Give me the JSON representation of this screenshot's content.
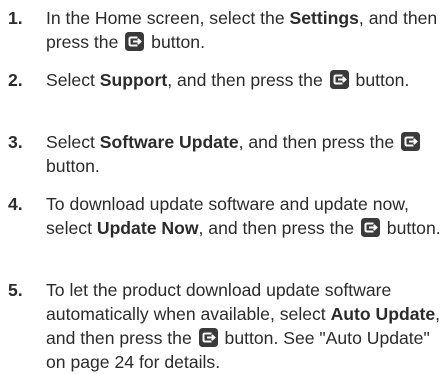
{
  "steps": [
    {
      "number": "1.",
      "parts": [
        {
          "t": "text",
          "v": "In the Home screen, select the "
        },
        {
          "t": "bold",
          "v": "Settings"
        },
        {
          "t": "text",
          "v": ", and then press the "
        },
        {
          "t": "icon",
          "v": "enter-button-icon"
        },
        {
          "t": "text",
          "v": " button."
        }
      ]
    },
    {
      "number": "2.",
      "parts": [
        {
          "t": "text",
          "v": "Select "
        },
        {
          "t": "bold",
          "v": "Support"
        },
        {
          "t": "text",
          "v": ", and then press the "
        },
        {
          "t": "icon",
          "v": "enter-button-icon"
        },
        {
          "t": "text",
          "v": " button."
        }
      ]
    },
    {
      "number": "3.",
      "parts": [
        {
          "t": "text",
          "v": "Select "
        },
        {
          "t": "bold",
          "v": "Software Update"
        },
        {
          "t": "text",
          "v": ", and then press the "
        },
        {
          "t": "icon",
          "v": "enter-button-icon"
        },
        {
          "t": "text",
          "v": " button."
        }
      ]
    },
    {
      "number": "4.",
      "parts": [
        {
          "t": "text",
          "v": "To download update software and update now, select "
        },
        {
          "t": "bold",
          "v": "Update Now"
        },
        {
          "t": "text",
          "v": ", and then press the "
        },
        {
          "t": "icon",
          "v": "enter-button-icon"
        },
        {
          "t": "text",
          "v": " button."
        }
      ]
    },
    {
      "number": "5.",
      "parts": [
        {
          "t": "text",
          "v": "To let the product download update software automatically when available, select "
        },
        {
          "t": "bold",
          "v": "Auto Update"
        },
        {
          "t": "text",
          "v": ", and then press the "
        },
        {
          "t": "icon",
          "v": "enter-button-icon"
        },
        {
          "t": "text",
          "v": " button. See \"Auto Update\" on page 24 for details."
        }
      ]
    }
  ],
  "colors": {
    "text": "#2b2b2b",
    "icon_bg": "#3a3a3a",
    "icon_fg": "#ffffff"
  }
}
